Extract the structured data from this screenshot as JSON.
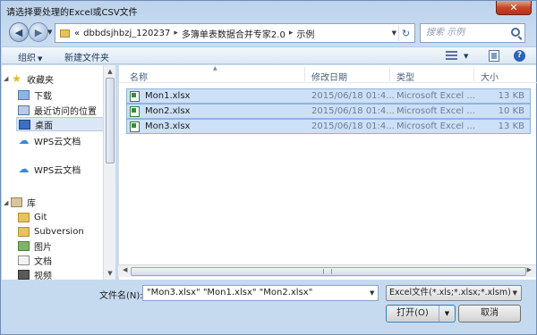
{
  "window": {
    "title": "请选择要处理的Excel或CSV文件",
    "close_label": "✕"
  },
  "address": {
    "overflow": "«",
    "segments": [
      "dbbdsjhbzj_120237",
      "多簿单表数据合并专家2.0",
      "示例"
    ],
    "separator": "▸"
  },
  "search": {
    "placeholder": "搜索 示例"
  },
  "toolbar": {
    "organize_label": "组织",
    "new_folder_label": "新建文件夹"
  },
  "nav": {
    "favorites_label": "收藏夹",
    "downloads_label": "下载",
    "recent_label": "最近访问的位置",
    "desktop_label": "桌面",
    "wps_cloud_fav_label": "WPS云文档",
    "wps_cloud_label": "WPS云文档",
    "libraries_label": "库",
    "git_label": "Git",
    "subversion_label": "Subversion",
    "pictures_label": "图片",
    "documents_label": "文档",
    "videos_label": "视频"
  },
  "columns": {
    "name": "名称",
    "modified": "修改日期",
    "type": "类型",
    "size": "大小"
  },
  "files": [
    {
      "name": "Mon1.xlsx",
      "modified": "2015/06/18 01:4...",
      "type": "Microsoft Excel ...",
      "size": "13 KB"
    },
    {
      "name": "Mon2.xlsx",
      "modified": "2015/06/18 01:4...",
      "type": "Microsoft Excel ...",
      "size": "10 KB"
    },
    {
      "name": "Mon3.xlsx",
      "modified": "2015/06/18 01:4...",
      "type": "Microsoft Excel ...",
      "size": "13 KB"
    }
  ],
  "footer": {
    "filename_label": "文件名(N):",
    "filename_value": "\"Mon3.xlsx\" \"Mon1.xlsx\" \"Mon2.xlsx\"",
    "filetype_value": "Excel文件(*.xls;*.xlsx;*.xlsm)",
    "open_label": "打开(O)",
    "cancel_label": "取消"
  }
}
